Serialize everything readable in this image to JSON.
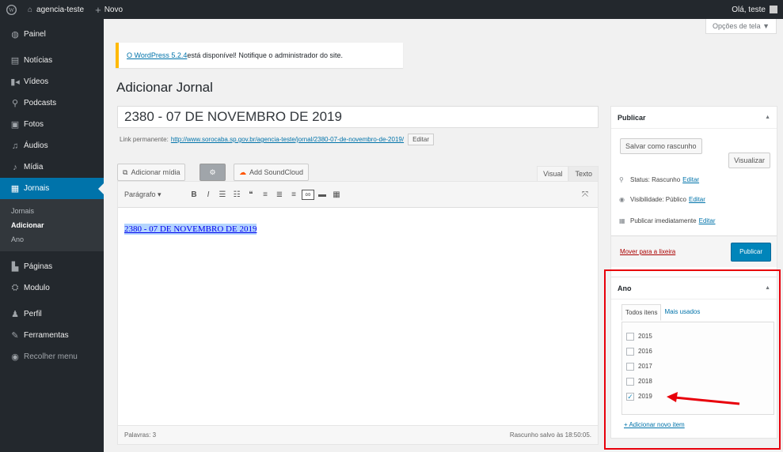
{
  "adminbar": {
    "site_name": "agencia-teste",
    "new_label": "Novo",
    "user_greeting": "Olá, teste"
  },
  "sidebar": {
    "items": [
      {
        "label": "Painel",
        "icon": "dashboard-icon"
      },
      {
        "label": "Notícias",
        "icon": "news-icon"
      },
      {
        "label": "Vídeos",
        "icon": "video-icon"
      },
      {
        "label": "Podcasts",
        "icon": "podcast-icon"
      },
      {
        "label": "Fotos",
        "icon": "photo-icon"
      },
      {
        "label": "Áudios",
        "icon": "audio-icon"
      },
      {
        "label": "Mídia",
        "icon": "media-icon"
      },
      {
        "label": "Jornais",
        "icon": "newspaper-icon",
        "current": true
      }
    ],
    "submenu": [
      "Jornais",
      "Adicionar",
      "Ano"
    ],
    "items_after": [
      {
        "label": "Páginas",
        "icon": "pages-icon"
      },
      {
        "label": "Modulo",
        "icon": "module-icon"
      },
      {
        "label": "Perfil",
        "icon": "user-icon"
      },
      {
        "label": "Ferramentas",
        "icon": "tools-icon"
      },
      {
        "label": "Recolher menu",
        "icon": "collapse-icon"
      }
    ]
  },
  "screen_options": "Opções de tela ▼",
  "notice": {
    "link": "O WordPress 5.2.4",
    "text": " está disponível! Notifique o administrador do site."
  },
  "page_title": "Adicionar Jornal",
  "post": {
    "title": "2380 - 07 DE NOVEMBRO DE 2019",
    "permalink_label": "Link permanente:",
    "permalink_url": "http://www.sorocaba.sp.gov.br/agencia-teste/jornal/2380-07-de-novembro-de-2019/",
    "edit_label": "Editar"
  },
  "editor": {
    "add_media": "Adicionar mídia",
    "soundcloud": "Add SoundCloud",
    "tab_visual": "Visual",
    "tab_text": "Texto",
    "format": "Parágrafo",
    "content_link": "2380 - 07 DE NOVEMBRO DE 2019",
    "word_count": "Palavras: 3",
    "draft_saved": "Rascunho salvo às 18:50:05."
  },
  "publish": {
    "title": "Publicar",
    "save_draft": "Salvar como rascunho",
    "preview": "Visualizar",
    "status_label": "Status: Rascunho",
    "visibility_label": "Visibilidade: Público",
    "schedule_label": "Publicar imediatamente",
    "edit": "Editar",
    "trash": "Mover para a lixeira",
    "publish_btn": "Publicar"
  },
  "ano": {
    "title": "Ano",
    "tab_all": "Todos itens",
    "tab_used": "Mais usados",
    "years": [
      {
        "label": "2015",
        "checked": false
      },
      {
        "label": "2016",
        "checked": false
      },
      {
        "label": "2017",
        "checked": false
      },
      {
        "label": "2018",
        "checked": false
      },
      {
        "label": "2019",
        "checked": true
      }
    ],
    "add_new": "+ Adicionar novo item"
  },
  "colors": {
    "accent": "#0073aa",
    "highlight": "#e8000b",
    "sidebar_bg": "#23282d"
  }
}
